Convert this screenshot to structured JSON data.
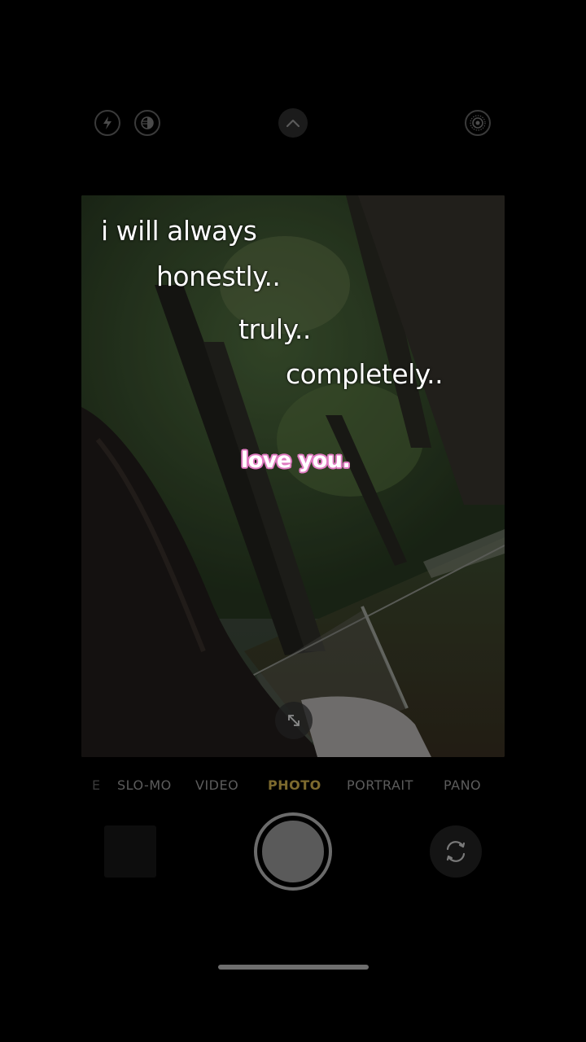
{
  "top_bar": {
    "icons": [
      "flash-icon",
      "night-mode-icon",
      "chevron-up-icon",
      "live-photo-icon"
    ]
  },
  "viewfinder": {
    "caption_lines": [
      "i will always",
      "honestly..",
      "truly..",
      "completely.."
    ],
    "highlight": "love you.",
    "highlight_color": "#e07bc1"
  },
  "modes": {
    "items": [
      "E",
      "SLO-MO",
      "VIDEO",
      "PHOTO",
      "PORTRAIT",
      "PANO"
    ],
    "active": "PHOTO",
    "active_color": "#7d6a2e"
  },
  "bottom_bar": {
    "icons": [
      "last-photo-thumbnail",
      "shutter-button",
      "flip-camera-icon"
    ]
  }
}
